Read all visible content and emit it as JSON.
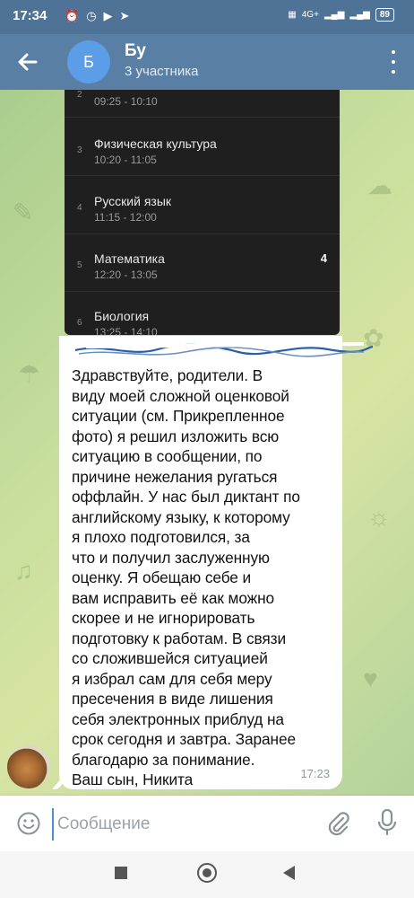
{
  "status_bar": {
    "time": "17:34",
    "battery": "89",
    "network": "4G+"
  },
  "header": {
    "avatar_letter": "Б",
    "title": "Бу",
    "subtitle": "3 участника"
  },
  "schedule": {
    "lessons": [
      {
        "num": "2",
        "name": "",
        "time": "09:25 - 10:10",
        "grade": ""
      },
      {
        "num": "3",
        "name": "Физическая культура",
        "time": "10:20 - 11:05",
        "grade": ""
      },
      {
        "num": "4",
        "name": "Русский язык",
        "time": "11:15 - 12:00",
        "grade": ""
      },
      {
        "num": "5",
        "name": "Математика",
        "time": "12:20 - 13:05",
        "grade": "4"
      },
      {
        "num": "6",
        "name": "Биология",
        "time": "13:25 - 14:10",
        "grade": ""
      }
    ]
  },
  "message": {
    "text": "Здравствуйте, родители. В\nвиду моей сложной оценковой\nситуации (см. Прикрепленное\nфото) я решил изложить всю\nситуацию в сообщении, по\nпричине нежелания ругаться\nоффлайн. У нас был диктант по\nанглийскому языку, к которому\nя плохо подготовился, за\nчто и получил заслуженную\nоценку. Я обещаю себе и\nвам исправить её как можно\nскорее и не игнорировать\nподготовку к работам. В связи\nсо сложившейся ситуацией\nя избрал сам для себя меру\nпресечения в виде лишения\nсебя электронных приблуд на\nсрок сегодня и завтра. Заранее\nблагодарю за понимание.\nВаш сын, Никита",
    "time": "17:23"
  },
  "input": {
    "placeholder": "Сообщение"
  },
  "colors": {
    "status_bar": "#4f7396",
    "app_bar": "#5a7fa4",
    "avatar": "#5b9de6",
    "bubble": "#ffffff",
    "schedule_bg": "#1f1f1f"
  }
}
